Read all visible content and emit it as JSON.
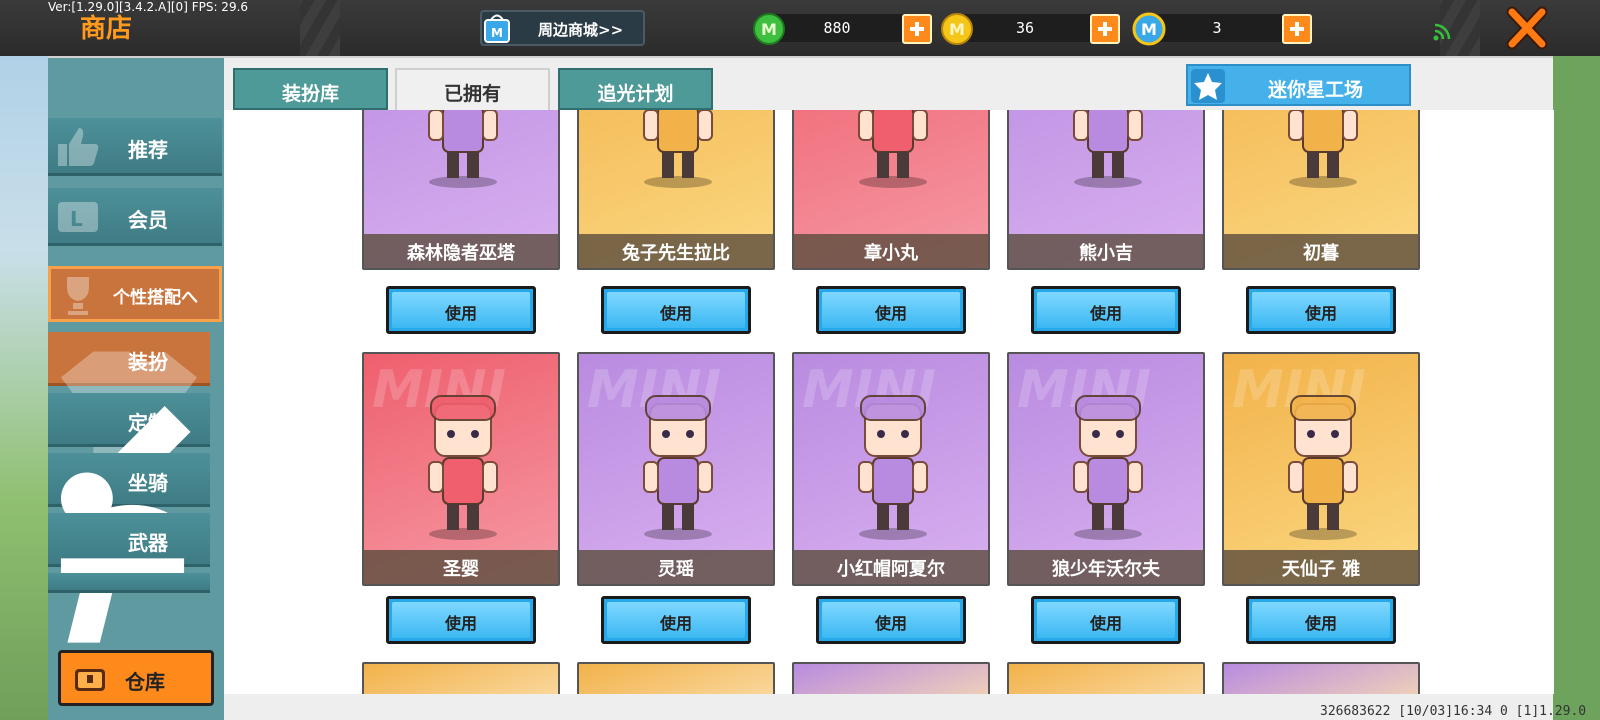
{
  "debug": {
    "text": "Ver:[1.29.0][3.4.2.A][0] FPS: 29.6"
  },
  "header": {
    "title": "商店",
    "mall_button": "周边商城>>",
    "currencies": [
      {
        "icon": "green-m-coin-icon",
        "value": "880",
        "color": "#3fbf3f"
      },
      {
        "icon": "gold-coin-icon",
        "value": "36",
        "color": "#f5c518"
      },
      {
        "icon": "blue-m-coin-icon",
        "value": "3",
        "color": "#39a8e8"
      }
    ]
  },
  "tabs": [
    {
      "label": "装扮库",
      "active": false
    },
    {
      "label": "已拥有",
      "active": true
    },
    {
      "label": "追光计划",
      "active": false
    }
  ],
  "star_factory": {
    "label": "迷你星工场"
  },
  "sidebar": {
    "items": [
      {
        "label": "推荐",
        "icon": "thumbs-up-icon"
      },
      {
        "label": "会员",
        "icon": "vip-card-icon"
      }
    ],
    "active_group": {
      "label": "个性搭配へ",
      "icon": "trophy-icon"
    },
    "sub_items": [
      {
        "label": "装扮",
        "icon": "shirt-icon",
        "active": true
      },
      {
        "label": "定制",
        "icon": "pencil-icon",
        "active": false
      },
      {
        "label": "坐骑",
        "icon": "mount-icon",
        "active": false
      },
      {
        "label": "武器",
        "icon": "gun-icon",
        "active": false
      }
    ],
    "warehouse_label": "仓库"
  },
  "cards": [
    {
      "name": "森林隐者巫塔",
      "bg": [
        "#b98be0",
        "#d9b0f0"
      ],
      "button": "使用"
    },
    {
      "name": "兔子先生拉比",
      "bg": [
        "#f2b24a",
        "#fbd882"
      ],
      "button": "使用"
    },
    {
      "name": "章小丸",
      "bg": [
        "#ef5f6e",
        "#f59aa4"
      ],
      "button": "使用"
    },
    {
      "name": "熊小吉",
      "bg": [
        "#b98be0",
        "#d9b0f0"
      ],
      "button": "使用"
    },
    {
      "name": "初暮",
      "bg": [
        "#f2b24a",
        "#fbd882"
      ],
      "button": "使用"
    },
    {
      "name": "圣婴",
      "bg": [
        "#ef5f6e",
        "#f59aa4"
      ],
      "button": "使用"
    },
    {
      "name": "灵瑶",
      "bg": [
        "#b98be0",
        "#d9b0f0"
      ],
      "button": "使用"
    },
    {
      "name": "小红帽阿夏尔",
      "bg": [
        "#b98be0",
        "#d9b0f0"
      ],
      "button": "使用"
    },
    {
      "name": "狼少年沃尔夫",
      "bg": [
        "#b98be0",
        "#d9b0f0"
      ],
      "button": "使用"
    },
    {
      "name": "天仙子 雅",
      "bg": [
        "#f2b24a",
        "#fbd882"
      ],
      "button": "使用"
    }
  ],
  "footer": {
    "text": "326683622    [10/03]16:34 0  [1]1.29.0"
  }
}
